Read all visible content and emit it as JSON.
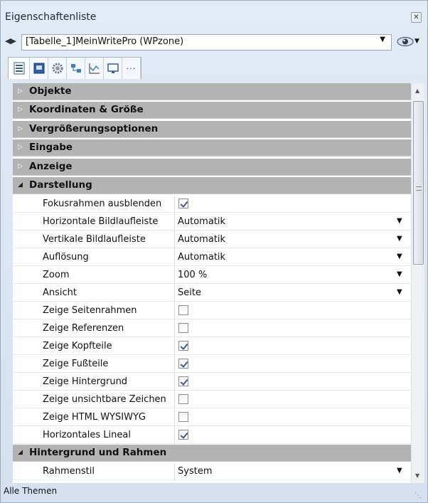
{
  "window": {
    "title": "Eigenschaftenliste"
  },
  "selector": {
    "value": "[Tabelle_1]MeinWritePro (WPzone)"
  },
  "toolbar": {
    "icons": [
      "list-icon",
      "object-icon",
      "gear-icon",
      "structure-icon",
      "chart-icon",
      "screen-icon",
      "more-icon"
    ]
  },
  "colors": {
    "group_bg": "#b3b3b3",
    "checkbox_check": "#3a5998"
  },
  "groups": {
    "objekte": "Objekte",
    "koordinaten": "Koordinaten & Größe",
    "vergroesserung": "Vergrößerungsoptionen",
    "eingabe": "Eingabe",
    "anzeige": "Anzeige",
    "darstellung": "Darstellung",
    "hintergrund": "Hintergrund und Rahmen"
  },
  "props": [
    {
      "label": "Fokusrahmen ausblenden",
      "type": "checkbox",
      "checked": true
    },
    {
      "label": "Horizontale Bildlaufleiste",
      "type": "dropdown",
      "value": "Automatik"
    },
    {
      "label": "Vertikale Bildlaufleiste",
      "type": "dropdown",
      "value": "Automatik"
    },
    {
      "label": "Auflösung",
      "type": "dropdown",
      "value": "Automatik"
    },
    {
      "label": "Zoom",
      "type": "dropdown",
      "value": "100 %"
    },
    {
      "label": "Ansicht",
      "type": "dropdown",
      "value": "Seite"
    },
    {
      "label": "Zeige Seitenrahmen",
      "type": "checkbox",
      "checked": false
    },
    {
      "label": "Zeige Referenzen",
      "type": "checkbox",
      "checked": false
    },
    {
      "label": "Zeige Kopfteile",
      "type": "checkbox",
      "checked": true
    },
    {
      "label": "Zeige Fußteile",
      "type": "checkbox",
      "checked": true
    },
    {
      "label": "Zeige Hintergrund",
      "type": "checkbox",
      "checked": true
    },
    {
      "label": "Zeige unsichtbare Zeichen",
      "type": "checkbox",
      "checked": false
    },
    {
      "label": "Zeige HTML WYSIWYG",
      "type": "checkbox",
      "checked": false
    },
    {
      "label": "Horizontales Lineal",
      "type": "checkbox",
      "checked": true
    }
  ],
  "props2": [
    {
      "label": "Rahmenstil",
      "type": "dropdown",
      "value": "System"
    }
  ],
  "status": {
    "text": "Alle Themen"
  }
}
